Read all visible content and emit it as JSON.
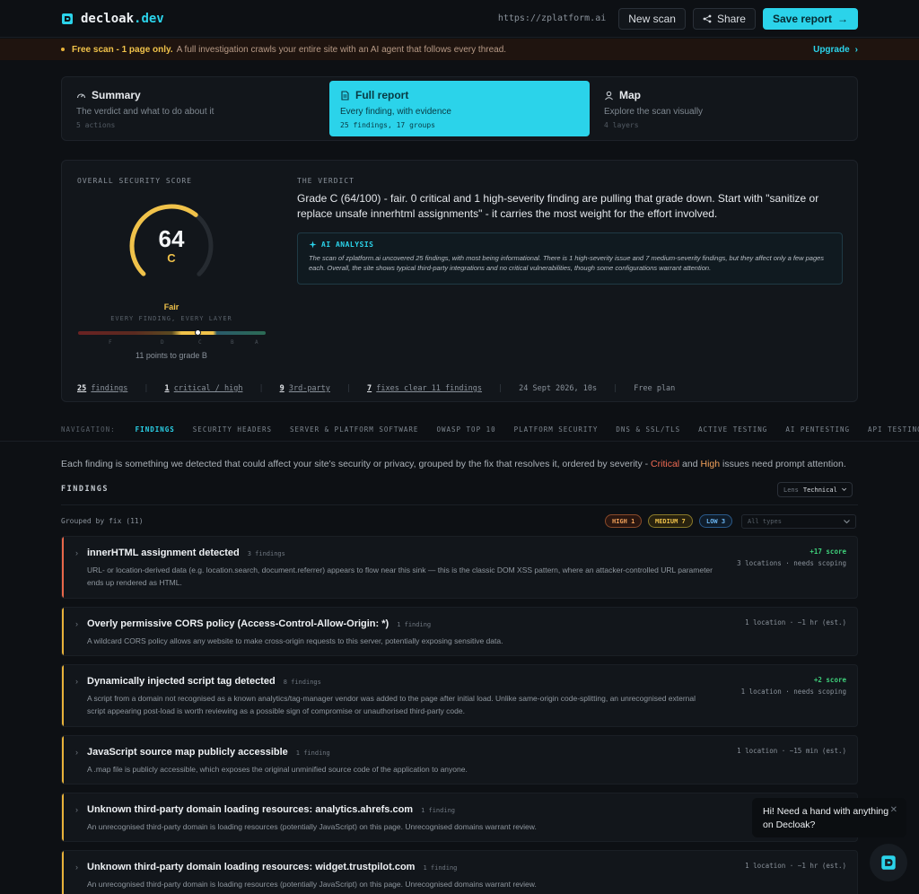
{
  "brand": {
    "name": "decloak",
    "tld": ".dev"
  },
  "header": {
    "scan_url": "https://zplatform.ai",
    "new_scan": "New scan",
    "share": "Share",
    "save_report": "Save report"
  },
  "banner": {
    "bold": "Free scan - 1 page only.",
    "text": "A full investigation crawls your entire site with an AI agent that follows every thread.",
    "upgrade": "Upgrade"
  },
  "view_tabs": [
    {
      "title": "Summary",
      "subtitle": "The verdict and what to do about it",
      "meta": "5 actions",
      "icon": "gauge-icon",
      "active": false
    },
    {
      "title": "Full report",
      "subtitle": "Every finding, with evidence",
      "meta": "25 findings, 17 groups",
      "icon": "document-icon",
      "active": true
    },
    {
      "title": "Map",
      "subtitle": "Explore the scan visually",
      "meta": "4 layers",
      "icon": "user-icon",
      "active": false
    }
  ],
  "score": {
    "label": "OVERALL SECURITY SCORE",
    "value": "64",
    "value_fraction": 0.64,
    "grade": "C",
    "rating": "Fair",
    "sub": "EVERY FINDING, EVERY LAYER",
    "scale_ticks": [
      "F",
      "D",
      "C",
      "B",
      "A"
    ],
    "marker_fraction": 0.64,
    "to_next": "11 points to grade B",
    "gauge_color": "#f0c24a"
  },
  "verdict": {
    "label": "THE VERDICT",
    "text": "Grade C (64/100) - fair. 0 critical and 1 high-severity finding are pulling that grade down. Start with \"sanitize or replace unsafe innerhtml assignments\" - it carries the most weight for the effort involved.",
    "ai_label": "AI ANALYSIS",
    "ai_text": "The scan of zplatform.ai uncovered 25 findings, with most being informational. There is 1 high-severity issue and 7 medium-severity findings, but they affect only a few pages each. Overall, the site shows typical third-party integrations and no critical vulnerabilities, though some configurations warrant attention."
  },
  "stats": {
    "findings_num": "25",
    "findings_label": "findings",
    "critical_num": "1",
    "critical_label": "critical / high",
    "third_num": "9",
    "third_label": "3rd-party",
    "fixes_num": "7",
    "fixes_label": "fixes clear 11 findings",
    "date": "24 Sept 2026, 10s",
    "plan": "Free plan"
  },
  "nav": {
    "label": "NAVIGATION:",
    "items": [
      "FINDINGS",
      "SECURITY HEADERS",
      "SERVER & PLATFORM SOFTWARE",
      "OWASP TOP 10",
      "PLATFORM SECURITY",
      "DNS & SSL/TLS",
      "ACTIVE TESTING",
      "AI PENTESTING",
      "API TESTING"
    ]
  },
  "intro": {
    "text": "Each finding is something we detected that could affect your site's security or privacy, grouped by the fix that resolves it, ordered by severity - ",
    "critical": "Critical",
    "and": " and ",
    "high": "High",
    "tail": " issues need prompt attention."
  },
  "findings": {
    "heading": "FINDINGS",
    "lens_label": "Lens",
    "lens_value": "Technical",
    "grouped": "Grouped by fix (11)",
    "pills": {
      "high": "HIGH 1",
      "medium": "MEDIUM 7",
      "low": "LOW 3"
    },
    "type_filter": "All types",
    "severity_colors": {
      "high": "#e8674a",
      "medium": "#e8b23a"
    },
    "rows": [
      {
        "title": "innerHTML assignment detected",
        "count": "3 findings",
        "desc": "URL- or location-derived data (e.g. location.search, document.referrer) appears to flow near this sink — this is the classic DOM XSS pattern, where an attacker-controlled URL parameter ends up rendered as HTML.",
        "score": "+17 score",
        "meta": "3 locations · needs scoping",
        "severity": "high"
      },
      {
        "title": "Overly permissive CORS policy (Access-Control-Allow-Origin: *)",
        "count": "1 finding",
        "desc": "A wildcard CORS policy allows any website to make cross-origin requests to this server, potentially exposing sensitive data.",
        "score": "",
        "meta": "1 location · ~1 hr (est.)",
        "severity": "medium"
      },
      {
        "title": "Dynamically injected script tag detected",
        "count": "8 findings",
        "desc": "A script from a domain not recognised as a known analytics/tag-manager vendor was added to the page after initial load. Unlike same-origin code-splitting, an unrecognised external script appearing post-load is worth reviewing as a possible sign of compromise or unauthorised third-party code.",
        "score": "+2 score",
        "meta": "1 location · needs scoping",
        "severity": "medium"
      },
      {
        "title": "JavaScript source map publicly accessible",
        "count": "1 finding",
        "desc": "A .map file is publicly accessible, which exposes the original unminified source code of the application to anyone.",
        "score": "",
        "meta": "1 location · ~15 min (est.)",
        "severity": "medium"
      },
      {
        "title": "Unknown third-party domain loading resources: analytics.ahrefs.com",
        "count": "1 finding",
        "desc": "An unrecognised third-party domain is loading resources (potentially JavaScript) on this page. Unrecognised domains warrant review.",
        "score": "",
        "meta": "1",
        "severity": "medium"
      },
      {
        "title": "Unknown third-party domain loading resources: widget.trustpilot.com",
        "count": "1 finding",
        "desc": "An unrecognised third-party domain is loading resources (potentially JavaScript) on this page. Unrecognised domains warrant review.",
        "score": "",
        "meta": "1 location · ~1 hr (est.)",
        "severity": "medium"
      }
    ]
  },
  "chat": {
    "text": "Hi! Need a hand with anything on Decloak?"
  }
}
